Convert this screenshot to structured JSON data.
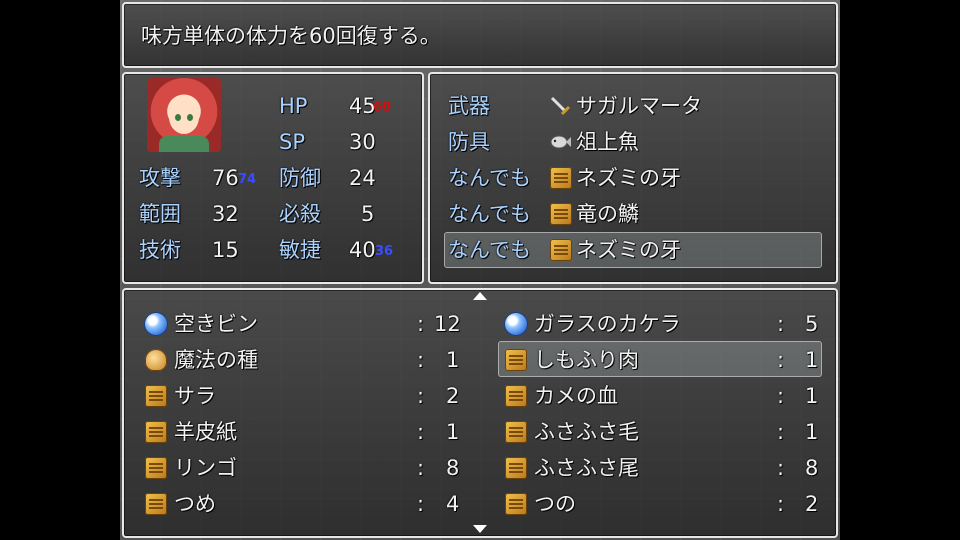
{
  "help": {
    "text": "味方単体の体力を60回復する。"
  },
  "status": {
    "hp_label": "HP",
    "hp_value": "45",
    "hp_delta": "60",
    "sp_label": "SP",
    "sp_value": "30",
    "atk_label": "攻撃",
    "atk_value": "76",
    "atk_delta": "74",
    "def_label": "防御",
    "def_value": "24",
    "rng_label": "範囲",
    "rng_value": "32",
    "crit_label": "必殺",
    "crit_value": "5",
    "tech_label": "技術",
    "tech_value": "15",
    "agi_label": "敏捷",
    "agi_value": "40",
    "agi_delta": "36"
  },
  "equipment": [
    {
      "slot": "武器",
      "item": "サガルマータ",
      "icon": "sword-icon"
    },
    {
      "slot": "防具",
      "item": "俎上魚",
      "icon": "fish-icon"
    },
    {
      "slot": "なんでも",
      "item": "ネズミの牙",
      "icon": "item-icon"
    },
    {
      "slot": "なんでも",
      "item": "竜の鱗",
      "icon": "item-icon"
    },
    {
      "slot": "なんでも",
      "item": "ネズミの牙",
      "icon": "item-icon",
      "selected": true
    }
  ],
  "inventory_left": [
    {
      "name": "空きビン",
      "sep": ":",
      "qty": "12",
      "icon": "orb-icon"
    },
    {
      "name": "魔法の種",
      "sep": ":",
      "qty": "1",
      "icon": "seed-icon"
    },
    {
      "name": "サラ",
      "sep": ":",
      "qty": "2",
      "icon": "item-icon"
    },
    {
      "name": "羊皮紙",
      "sep": ":",
      "qty": "1",
      "icon": "item-icon"
    },
    {
      "name": "リンゴ",
      "sep": ":",
      "qty": "8",
      "icon": "item-icon"
    },
    {
      "name": "つめ",
      "sep": ":",
      "qty": "4",
      "icon": "item-icon"
    }
  ],
  "inventory_right": [
    {
      "name": "ガラスのカケラ",
      "sep": ":",
      "qty": "5",
      "icon": "orb-icon"
    },
    {
      "name": "しもふり肉",
      "sep": ":",
      "qty": "1",
      "icon": "item-icon",
      "selected": true
    },
    {
      "name": "カメの血",
      "sep": ":",
      "qty": "1",
      "icon": "item-icon"
    },
    {
      "name": "ふさふさ毛",
      "sep": ":",
      "qty": "1",
      "icon": "item-icon"
    },
    {
      "name": "ふさふさ尾",
      "sep": ":",
      "qty": "8",
      "icon": "item-icon"
    },
    {
      "name": "つの",
      "sep": ":",
      "qty": "2",
      "icon": "item-icon"
    }
  ],
  "colors": {
    "label": "#a9d2ff",
    "delta_blue": "#3a4cff",
    "delta_red": "#d01010"
  }
}
